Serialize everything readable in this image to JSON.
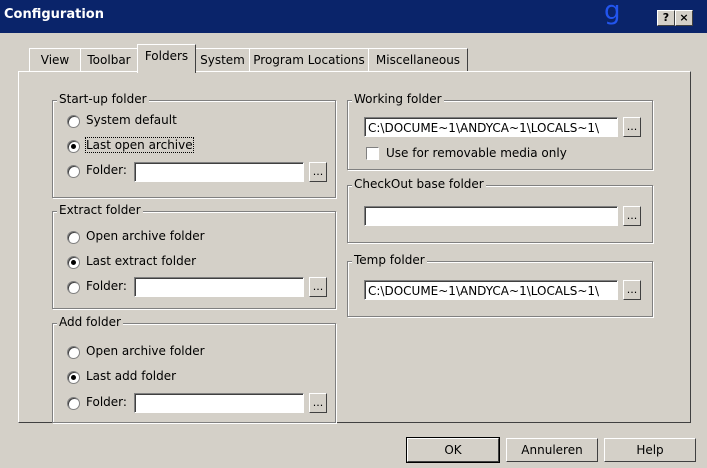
{
  "window": {
    "title": "Configuration",
    "help_button": "?",
    "close_button": "×",
    "artifact_glyph": "g"
  },
  "tabs": [
    {
      "label": "View"
    },
    {
      "label": "Toolbar"
    },
    {
      "label": "Folders",
      "active": true
    },
    {
      "label": "System"
    },
    {
      "label": "Program Locations"
    },
    {
      "label": "Miscellaneous"
    }
  ],
  "startup_folder": {
    "legend": "Start-up folder",
    "options": [
      "System default",
      "Last open archive",
      "Folder:"
    ],
    "selected": "Last open archive",
    "folder_value": "",
    "browse": "..."
  },
  "extract_folder": {
    "legend": "Extract folder",
    "options": [
      "Open archive folder",
      "Last extract folder",
      "Folder:"
    ],
    "selected": "Last extract folder",
    "folder_value": "",
    "browse": "..."
  },
  "add_folder": {
    "legend": "Add folder",
    "options": [
      "Open archive folder",
      "Last add folder",
      "Folder:"
    ],
    "selected": "Last add folder",
    "folder_value": "",
    "browse": "..."
  },
  "working_folder": {
    "legend": "Working folder",
    "value": "C:\\DOCUME~1\\ANDYCA~1\\LOCALS~1\\",
    "browse": "...",
    "checkbox_label": "Use for removable media only",
    "checked": false
  },
  "checkout_folder": {
    "legend": "CheckOut base folder",
    "value": "",
    "browse": "..."
  },
  "temp_folder": {
    "legend": "Temp folder",
    "value": "C:\\DOCUME~1\\ANDYCA~1\\LOCALS~1\\",
    "browse": "..."
  },
  "buttons": {
    "ok": "OK",
    "cancel": "Annuleren",
    "help": "Help"
  }
}
